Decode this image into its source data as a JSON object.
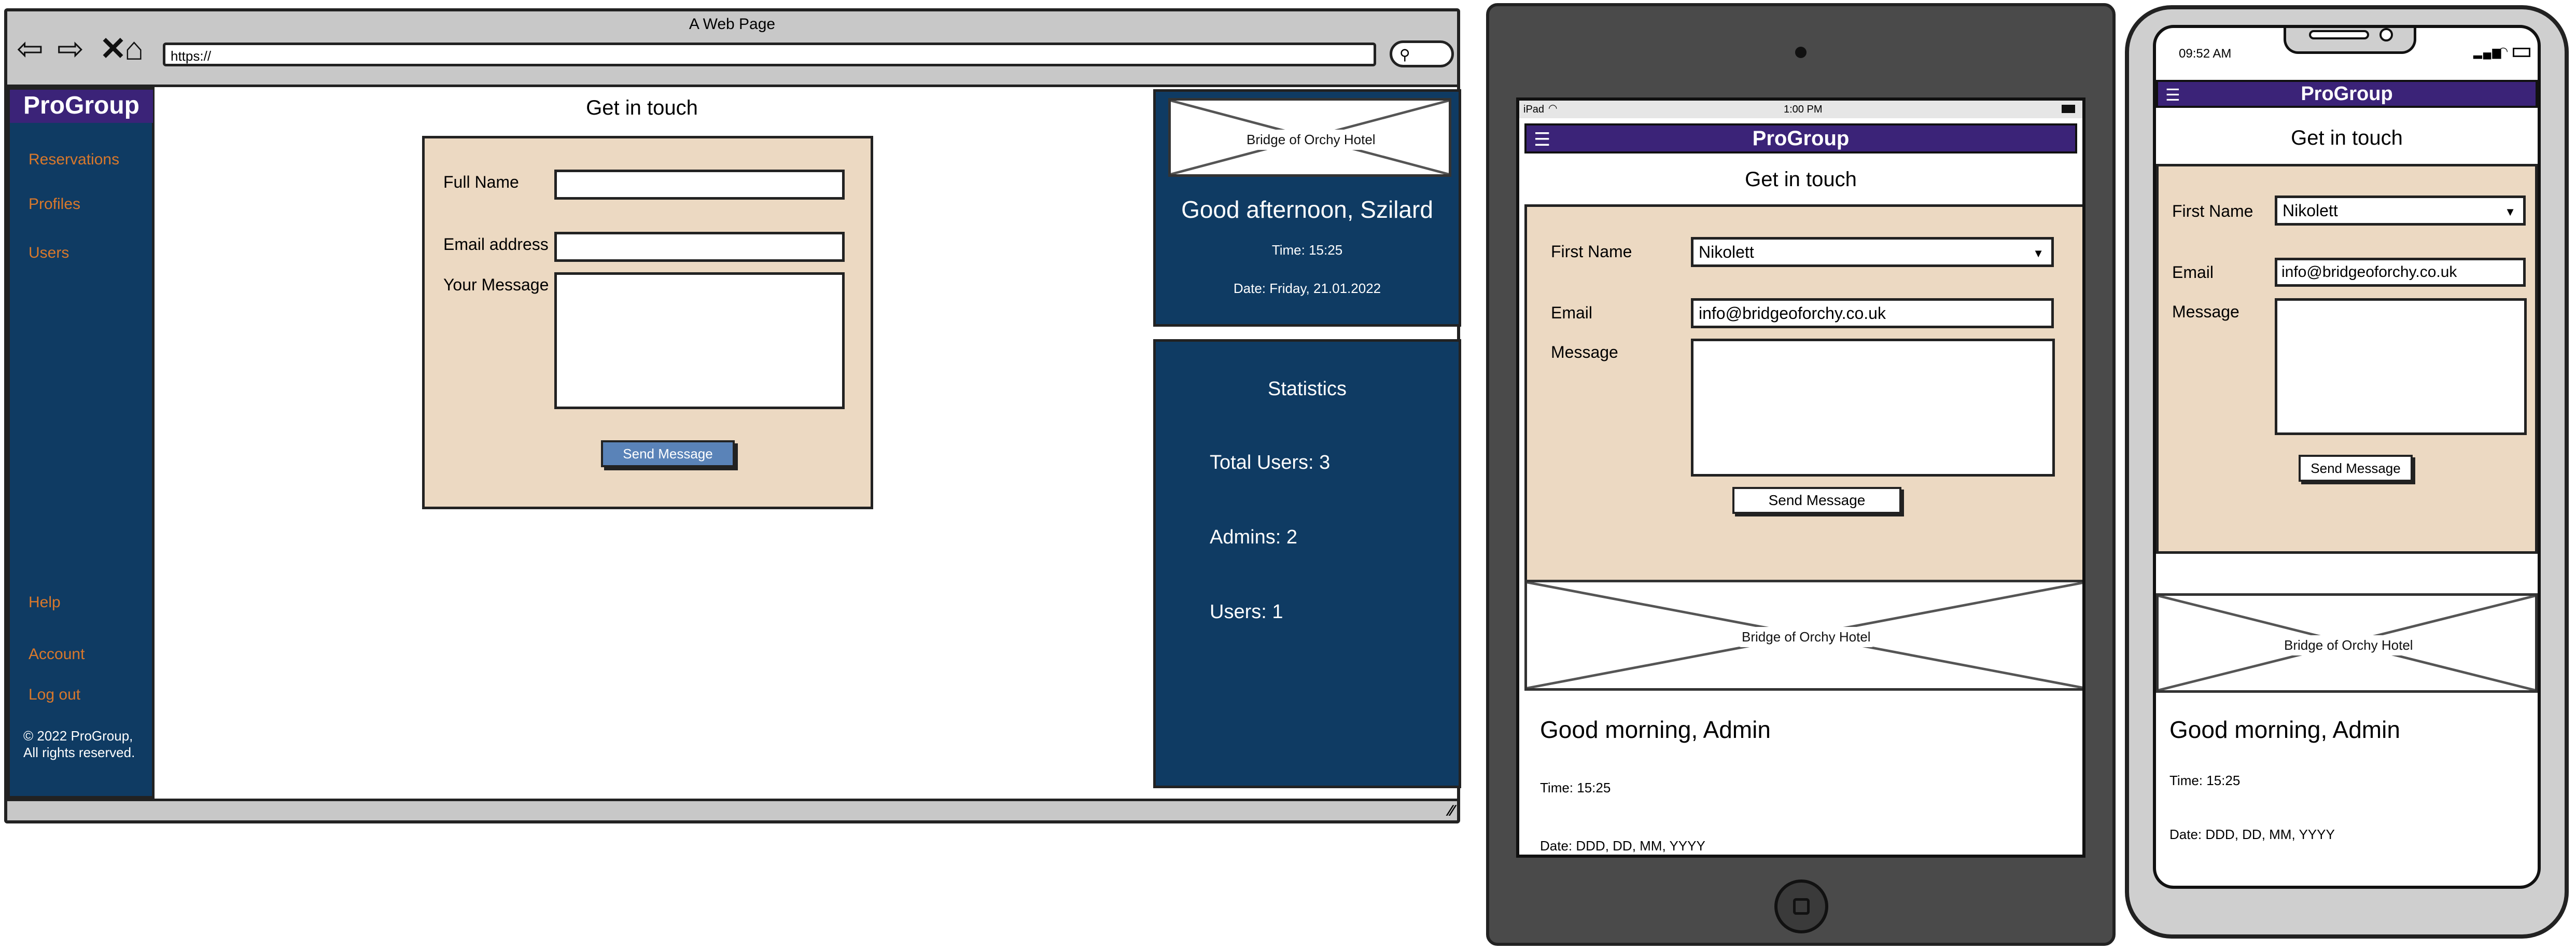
{
  "desktop": {
    "window_title": "A Web Page",
    "url": "https://",
    "brand": "ProGroup",
    "nav": {
      "reservations": "Reservations",
      "profiles": "Profiles",
      "users": "Users",
      "help": "Help",
      "account": "Account",
      "logout": "Log out"
    },
    "footer_line1": "© 2022 ProGroup,",
    "footer_line2": "All rights reserved.",
    "form": {
      "heading": "Get in touch",
      "full_name_label": "Full Name",
      "email_label": "Email address",
      "message_label": "Your Message",
      "send_label": "Send Message"
    },
    "hotel_image_label": "Bridge of Orchy Hotel",
    "greeting": "Good afternoon, Szilard",
    "time": "Time: 15:25",
    "date": "Date: Friday, 21.01.2022",
    "stats": {
      "title": "Statistics",
      "total_users": "Total Users: 3",
      "admins": "Admins: 2",
      "users": "Users: 1"
    }
  },
  "tablet": {
    "status_left": "iPad",
    "status_time": "1:00 PM",
    "brand": "ProGroup",
    "heading": "Get in touch",
    "first_name_label": "First Name",
    "first_name_value": "Nikolett",
    "email_label": "Email",
    "email_value": "info@bridgeoforchy.co.uk",
    "message_label": "Message",
    "send_label": "Send Message",
    "hotel_image_label": "Bridge of Orchy Hotel",
    "greeting": "Good morning, Admin",
    "time": "Time: 15:25",
    "date": "Date: DDD, DD, MM, YYYY"
  },
  "phone": {
    "status_time": "09:52 AM",
    "brand": "ProGroup",
    "heading": "Get in touch",
    "first_name_label": "First Name",
    "first_name_value": "Nikolett",
    "email_label": "Email",
    "email_value": "info@bridgeoforchy.co.uk",
    "message_label": "Message",
    "send_label": "Send Message",
    "hotel_image_label": "Bridge of Orchy Hotel",
    "greeting": "Good morning, Admin",
    "time": "Time: 15:25",
    "date": "Date: DDD, DD, MM, YYYY"
  },
  "icons": {
    "back": "back-arrow-icon",
    "forward": "forward-arrow-icon",
    "close": "close-icon",
    "home": "home-icon",
    "search": "search-icon",
    "menu": "hamburger-menu-icon",
    "dropdown": "chevron-down-icon",
    "home_button": "home-button-icon"
  },
  "colors": {
    "brand_purple": "#3b2378",
    "navy": "#0f3b63",
    "form_beige": "#ecd9c2",
    "link_orange": "#d9782b",
    "button_blue": "#5a83b8"
  }
}
